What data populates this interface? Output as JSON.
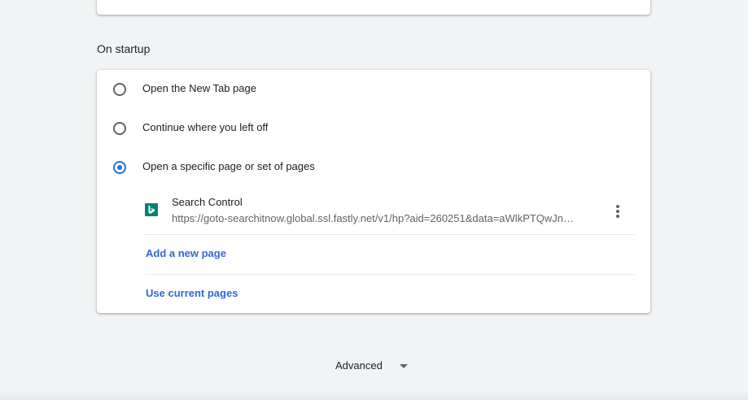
{
  "on_startup": {
    "title": "On startup",
    "options": [
      {
        "label": "Open the New Tab page",
        "checked": false
      },
      {
        "label": "Continue where you left off",
        "checked": false
      },
      {
        "label": "Open a specific page or set of pages",
        "checked": true
      }
    ],
    "pages": [
      {
        "icon": "bing-favicon-icon",
        "title": "Search Control",
        "url": "https://goto-searchitnow.global.ssl.fastly.net/v1/hp?aid=260251&data=aWlkPTQwJn…"
      }
    ],
    "add_page_label": "Add a new page",
    "use_current_label": "Use current pages"
  },
  "advanced": {
    "label": "Advanced"
  },
  "colors": {
    "accent": "#1a73e8",
    "link": "#3367d6",
    "favicon": "#008373",
    "background": "#f1f3f4"
  }
}
